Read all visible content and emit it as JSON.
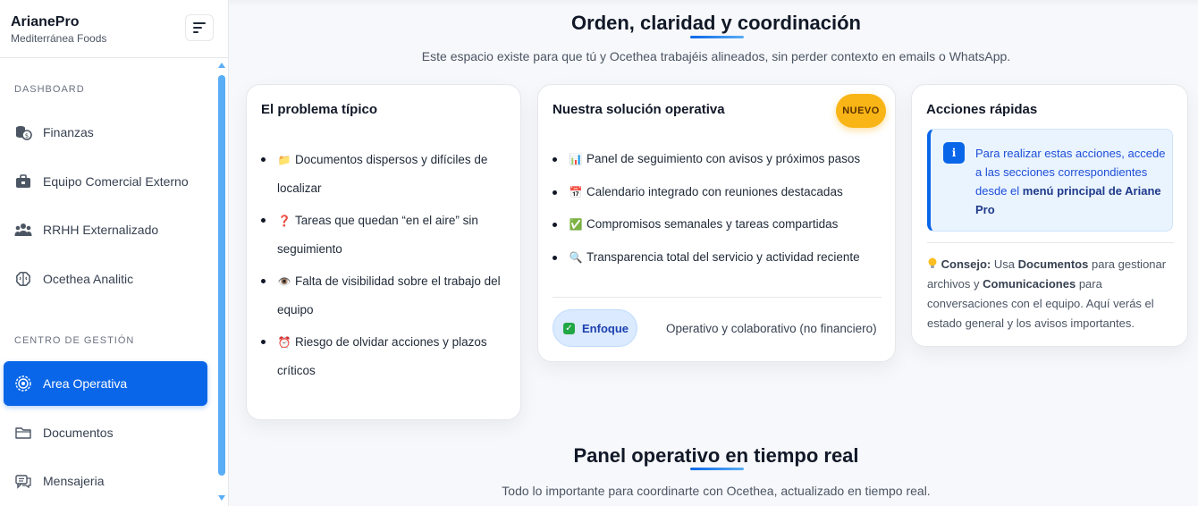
{
  "sidebar": {
    "brand_title": "ArianePro",
    "brand_subtitle": "Mediterránea Foods",
    "section_dashboard": "DASHBOARD",
    "section_gestion": "CENTRO DE GESTIÓN",
    "items": [
      {
        "label": "Finanzas",
        "icon": "coins-icon"
      },
      {
        "label": "Equipo Comercial Externo",
        "icon": "briefcase-icon"
      },
      {
        "label": "RRHH Externalizado",
        "icon": "users-icon"
      },
      {
        "label": "Ocethea Analitic",
        "icon": "brain-icon"
      },
      {
        "label": "Area Operativa",
        "icon": "cog-icon",
        "active": true
      },
      {
        "label": "Documentos",
        "icon": "folder-icon"
      },
      {
        "label": "Mensajeria",
        "icon": "chat-icon"
      }
    ]
  },
  "main": {
    "section1": {
      "title": "Orden, claridad y coordinación",
      "subtitle": "Este espacio existe para que tú y Ocethea trabajéis alineados, sin perder contexto en emails o WhatsApp."
    },
    "problem_card": {
      "title": "El problema típico",
      "items": [
        {
          "emoji": "📁",
          "text": "Documentos dispersos y difíciles de localizar"
        },
        {
          "emoji": "❓",
          "text": "Tareas que quedan “en el aire” sin seguimiento"
        },
        {
          "emoji": "👁️",
          "text": "Falta de visibilidad sobre el trabajo del equipo"
        },
        {
          "emoji": "⏰",
          "text": "Riesgo de olvidar acciones y plazos críticos"
        }
      ]
    },
    "solution_card": {
      "title": "Nuestra solución operativa",
      "badge": "NUEVO",
      "items": [
        {
          "emoji": "📊",
          "text": "Panel de seguimiento con avisos y próximos pasos"
        },
        {
          "emoji": "📅",
          "text": "Calendario integrado con reuniones destacadas"
        },
        {
          "emoji": "✅",
          "text": "Compromisos semanales y tareas compartidas"
        },
        {
          "emoji": "🔍",
          "text": "Transparencia total del servicio y actividad reciente"
        }
      ],
      "focus_label": "Enfoque",
      "focus_desc": "Operativo y colaborativo (no financiero)"
    },
    "actions_card": {
      "title": "Acciones rápidas",
      "info_icon": "i",
      "info_text": "Para realizar estas acciones, accede a las secciones correspondientes desde el",
      "info_bold": "menú principal de Ariane Pro",
      "tip_label": "Consejo:",
      "tip_t1": "Usa",
      "tip_b1": "Documentos",
      "tip_t2": "para gestionar archivos y",
      "tip_b2": "Comunicaciones",
      "tip_t3": "para conversaciones con el equipo. Aquí verás el estado general y los avisos importantes."
    },
    "section2": {
      "title": "Panel operativo en tiempo real",
      "subtitle": "Todo lo importante para coordinarte con Ocethea, actualizado en tiempo real."
    }
  },
  "colors": {
    "accent": "#0a66e8",
    "badge": "#f9b516",
    "scrollbar": "#5aaef5"
  }
}
